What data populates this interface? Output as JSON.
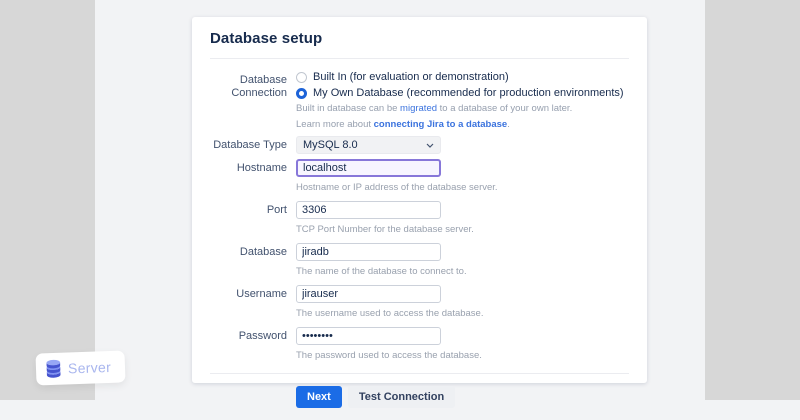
{
  "page": {
    "title": "Database setup"
  },
  "form": {
    "connection": {
      "label": "Database Connection",
      "options": [
        {
          "label": "Built In (for evaluation or demonstration)",
          "selected": false
        },
        {
          "label": "My Own Database (recommended for production environments)",
          "selected": true
        }
      ],
      "note_migrate": {
        "pre": "Built in database can be ",
        "link": "migrated",
        "post": " to a database of your own later."
      },
      "note_learn": {
        "pre": "Learn more about ",
        "link": "connecting Jira to a database",
        "post": "."
      }
    },
    "fields": {
      "database_type": {
        "label": "Database Type",
        "value": "MySQL 8.0"
      },
      "hostname": {
        "label": "Hostname",
        "value": "localhost",
        "helper": "Hostname or IP address of the database server."
      },
      "port": {
        "label": "Port",
        "value": "3306",
        "helper": "TCP Port Number for the database server."
      },
      "database": {
        "label": "Database",
        "value": "jiradb",
        "helper": "The name of the database to connect to."
      },
      "username": {
        "label": "Username",
        "value": "jirauser",
        "helper": "The username used to access the database."
      },
      "password": {
        "label": "Password",
        "value": "••••••••",
        "helper": "The password used to access the database."
      }
    },
    "buttons": {
      "next": "Next",
      "test": "Test Connection"
    }
  },
  "badge": {
    "label": "Server"
  },
  "colors": {
    "accent_blue": "#1b6ce6",
    "radio_selected": "#1d63d8",
    "focus_border_purple": "#8777d9",
    "title_text": "#172b4d",
    "label_text": "#42526e",
    "helper_text": "#99a1ae",
    "link_blue": "#3b73de"
  }
}
